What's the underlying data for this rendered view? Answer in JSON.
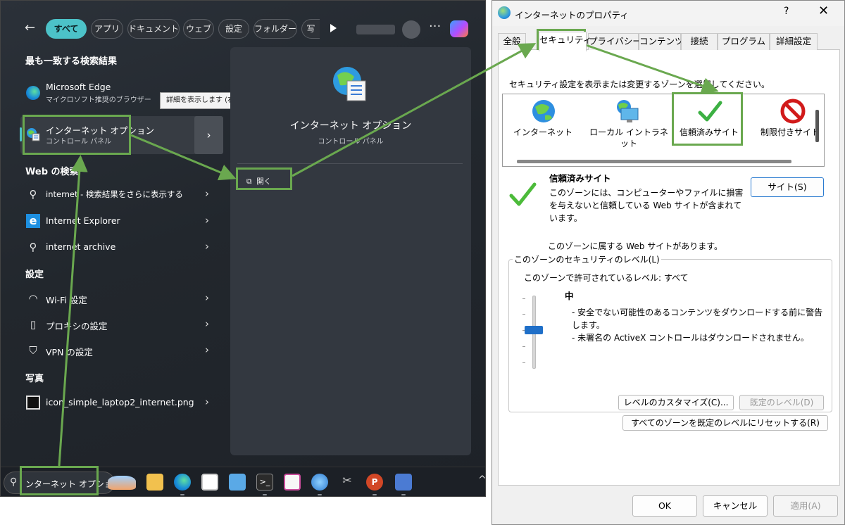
{
  "search": {
    "filters": [
      "すべて",
      "アプリ",
      "ドキュメント",
      "ウェブ",
      "設定",
      "フォルダー",
      "写"
    ],
    "best_match_header": "最も一致する検索結果",
    "best": [
      {
        "title": "Microsoft Edge",
        "sub": "マイクロソフト推奨のブラウザー"
      },
      {
        "title": "インターネット オプション",
        "sub": "コントロール パネル"
      }
    ],
    "tooltip": "詳細を表示します (右矢印)",
    "web_header": "Web の検索",
    "web": [
      "internet - 検索結果をさらに表示する",
      "Internet Explorer",
      "internet archive"
    ],
    "settings_header": "設定",
    "settings": [
      "Wi-Fi 設定",
      "プロキシの設定",
      "VPN の設定"
    ],
    "photos_header": "写真",
    "photos": [
      "icon_simple_laptop2_internet.png"
    ],
    "detail": {
      "title": "インターネット オプション",
      "subtitle": "コントロール パネル",
      "open": "開く"
    },
    "taskbar_query": "ンターネット オプション"
  },
  "dialog": {
    "title": "インターネットのプロパティ",
    "help": "?",
    "close": "✕",
    "tabs": [
      "全般",
      "セキュリティ",
      "プライバシー",
      "コンテンツ",
      "接続",
      "プログラム",
      "詳細設定"
    ],
    "instruction": "セキュリティ設定を表示または変更するゾーンを選択してください。",
    "zones": [
      "インターネット",
      "ローカル イントラネット",
      "信頼済みサイト",
      "制限付きサイト"
    ],
    "selected_zone_title": "信頼済みサイト",
    "selected_zone_desc": "このゾーンには、コンピューターやファイルに損害を与えないと信頼している Web サイトが含まれています。",
    "sites_button": "サイト(S)",
    "site_note": "このゾーンに属する Web サイトがあります。",
    "level_group": "このゾーンのセキュリティのレベル(L)",
    "allowed": "このゾーンで許可されているレベル: すべて",
    "level_name": "中",
    "level_desc1": "- 安全でない可能性のあるコンテンツをダウンロードする前に警告します。",
    "level_desc2": "- 未署名の ActiveX コントロールはダウンロードされません。",
    "customize_btn": "レベルのカスタマイズ(C)...",
    "default_btn": "既定のレベル(D)",
    "reset_btn": "すべてのゾーンを既定のレベルにリセットする(R)",
    "ok": "OK",
    "cancel": "キャンセル",
    "apply": "適用(A)"
  },
  "colors": {
    "accent": "#4cc2c8",
    "highlight": "#6aa84f",
    "slider": "#1f6fc8"
  }
}
